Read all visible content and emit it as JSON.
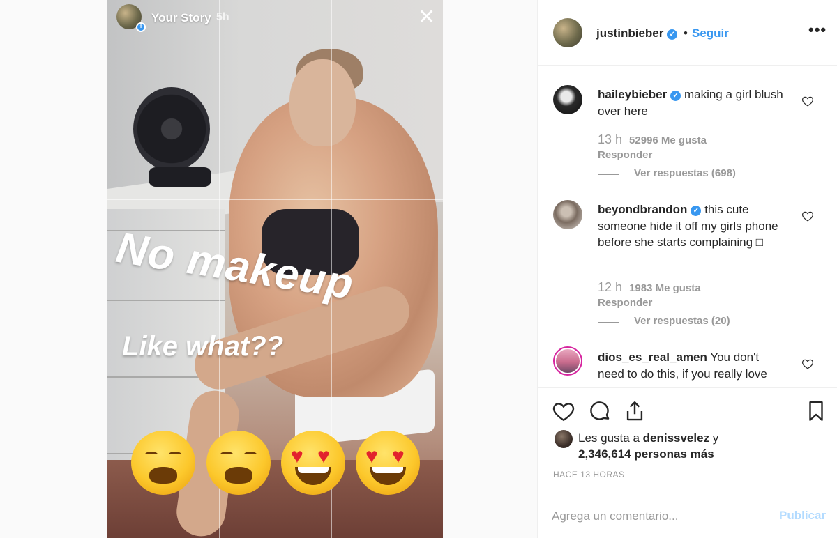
{
  "story": {
    "title": "Your Story",
    "time": "5h",
    "close_icon": "close-icon",
    "overlay_headline": "No makeup",
    "overlay_subline": "Like what??",
    "emojis": [
      "weary-face",
      "weary-face",
      "heart-eyes-face",
      "heart-eyes-face"
    ]
  },
  "header": {
    "username": "justinbieber",
    "separator": "•",
    "follow_label": "Seguir",
    "more_label": "•••"
  },
  "comments": [
    {
      "username": "haileybieber",
      "text": "making a girl blush over here",
      "time": "13 h",
      "likes": "52996 Me gusta",
      "reply_label": "Responder",
      "view_replies": "Ver respuestas (698)"
    },
    {
      "username": "beyondbrandon",
      "text": "this cute someone hide it off my girls phone before she starts complaining □",
      "time": "12 h",
      "likes": "1983 Me gusta",
      "reply_label": "Responder",
      "view_replies": "Ver respuestas (20)"
    },
    {
      "username": "dios_es_real_amen",
      "text": "You don't need to do this, if you really love"
    }
  ],
  "likes": {
    "prefix": "Les gusta a ",
    "user": "denissvelez",
    "suffix": " y",
    "count_line": "2,346,614 personas más"
  },
  "posted": "HACE 13 HORAS",
  "add_comment": {
    "placeholder": "Agrega un comentario...",
    "publish_label": "Publicar"
  },
  "colors": {
    "accent": "#3897f0",
    "publish_disabled": "#b3dbff",
    "muted": "#999999"
  }
}
